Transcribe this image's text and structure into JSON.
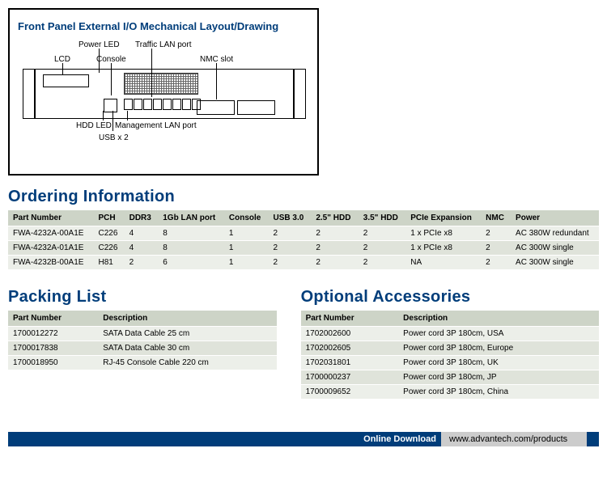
{
  "panel": {
    "title": "Front Panel External I/O Mechanical Layout/Drawing",
    "labels": {
      "lcd": "LCD",
      "power_led": "Power LED",
      "console": "Console",
      "traffic_lan": "Traffic LAN port",
      "nmc_slot": "NMC slot",
      "hdd_led": "HDD LED",
      "usb": "USB x 2",
      "mgmt_lan": "Management LAN port"
    }
  },
  "ordering": {
    "title": "Ordering Information",
    "headers": [
      "Part Number",
      "PCH",
      "DDR3",
      "1Gb LAN port",
      "Console",
      "USB 3.0",
      "2.5\" HDD",
      "3.5\" HDD",
      "PCIe Expansion",
      "NMC",
      "Power"
    ],
    "rows": [
      [
        "FWA-4232A-00A1E",
        "C226",
        "4",
        "8",
        "1",
        "2",
        "2",
        "2",
        "1 x PCIe x8",
        "2",
        "AC 380W redundant"
      ],
      [
        "FWA-4232A-01A1E",
        "C226",
        "4",
        "8",
        "1",
        "2",
        "2",
        "2",
        "1 x PCIe x8",
        "2",
        "AC 300W single"
      ],
      [
        "FWA-4232B-00A1E",
        "H81",
        "2",
        "6",
        "1",
        "2",
        "2",
        "2",
        "NA",
        "2",
        "AC 300W single"
      ]
    ]
  },
  "packing": {
    "title": "Packing List",
    "headers": [
      "Part Number",
      "Description"
    ],
    "rows": [
      [
        "1700012272",
        "SATA Data Cable 25 cm"
      ],
      [
        "1700017838",
        "SATA Data Cable 30 cm"
      ],
      [
        "1700018950",
        "RJ-45 Console Cable 220 cm"
      ]
    ]
  },
  "accessories": {
    "title": "Optional Accessories",
    "headers": [
      "Part Number",
      "Description"
    ],
    "rows": [
      [
        "1702002600",
        "Power cord 3P 180cm, USA"
      ],
      [
        "1702002605",
        "Power cord 3P 180cm, Europe"
      ],
      [
        "1702031801",
        "Power cord 3P 180cm, UK"
      ],
      [
        "1700000237",
        "Power cord 3P 180cm, JP"
      ],
      [
        "1700009652",
        "Power cord 3P 180cm, China"
      ]
    ]
  },
  "footer": {
    "label": "Online Download",
    "url": "www.advantech.com/products"
  }
}
